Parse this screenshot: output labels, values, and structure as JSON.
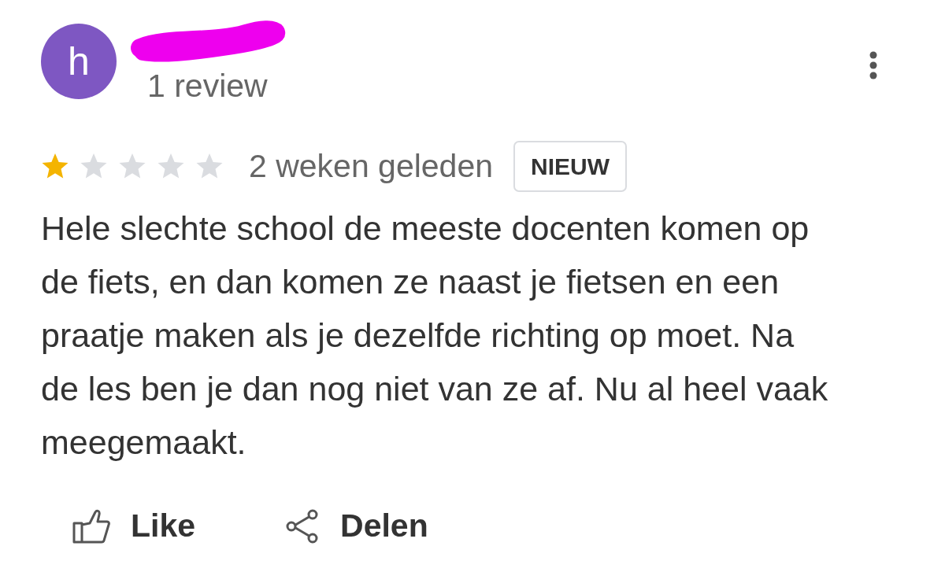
{
  "review": {
    "author": {
      "avatar_letter": "h",
      "name_redacted": true,
      "review_count": "1 review"
    },
    "stars": 1,
    "time": "2 weken geleden",
    "badge": "NIEUW",
    "text": "Hele slechte school de meeste docenten komen op de fiets, en dan komen ze naast je fietsen en een praatje maken als je dezelfde richting op moet. Na de les ben je dan nog niet van ze af. Nu al heel vaak meegemaakt.",
    "actions": [
      {
        "kind": "like",
        "label": "Like"
      },
      {
        "kind": "share",
        "label": "Delen"
      }
    ]
  }
}
